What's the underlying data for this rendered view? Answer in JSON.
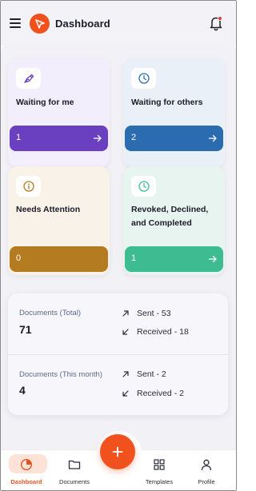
{
  "header": {
    "title": "Dashboard",
    "accent": "#f1521d",
    "notification_dot": true
  },
  "cards": [
    {
      "title": "Waiting for me",
      "count": "1",
      "icon": "pen-nib-icon",
      "bar_color": "#6a3fc0"
    },
    {
      "title": "Waiting for others",
      "count": "2",
      "icon": "clock-icon",
      "bar_color": "#2b6cb0"
    },
    {
      "title": "Needs Attention",
      "count": "0",
      "icon": "info-icon",
      "bar_color": "#b57b20"
    },
    {
      "title_line1": "Revoked, Declined,",
      "title_line2": "and Completed",
      "count": "1",
      "icon": "clock-icon",
      "bar_color": "#3dbb91"
    }
  ],
  "stats": {
    "total": {
      "label": "Documents (Total)",
      "value": "71",
      "sent": "Sent - 53",
      "received": "Received - 18"
    },
    "month": {
      "label": "Documents (This month)",
      "value": "4",
      "sent": "Sent - 2",
      "received": "Received - 2"
    }
  },
  "nav": {
    "dashboard": "Dashboard",
    "documents": "Documents",
    "templates": "Templates",
    "profile": "Profile",
    "fab_icon": "plus-icon"
  }
}
